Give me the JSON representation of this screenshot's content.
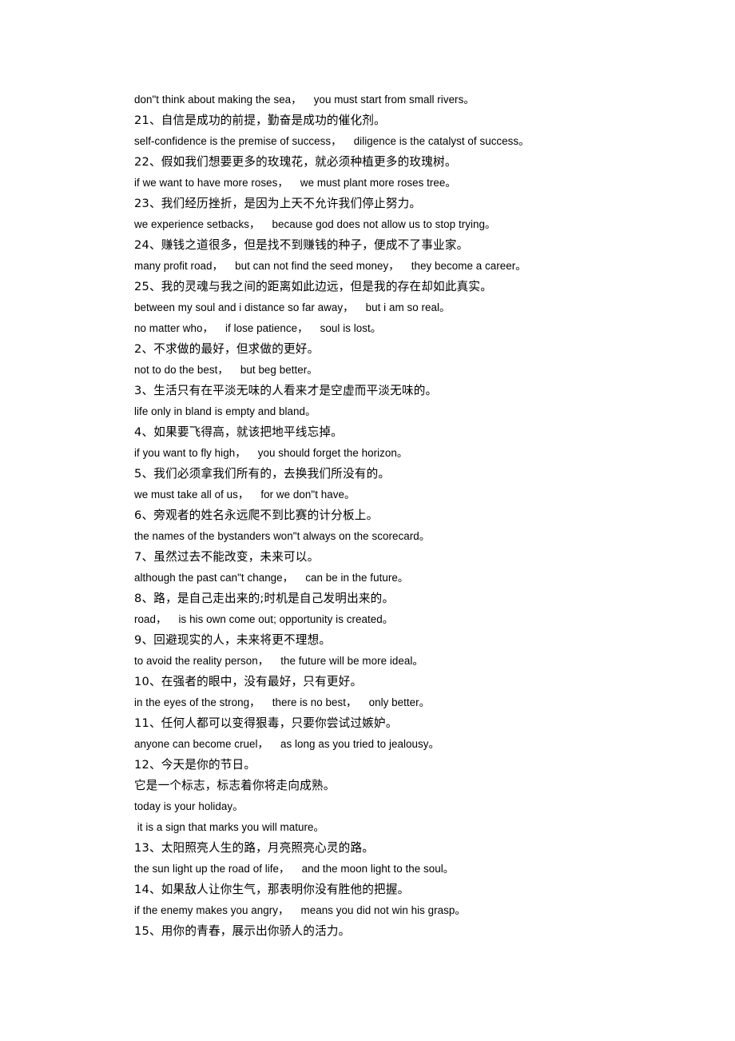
{
  "document": {
    "page_background": "#ffffff",
    "text_color": "#000000",
    "lines": [
      {
        "id": "l1",
        "script": "latin",
        "text": "don\"t think about making the sea，    you must start from small rivers。"
      },
      {
        "id": "l2",
        "script": "cjk",
        "text": "21、自信是成功的前提，勤奋是成功的催化剂。"
      },
      {
        "id": "l3",
        "script": "latin",
        "text": "self-confidence is the premise of success，    diligence is the catalyst of success。"
      },
      {
        "id": "l4",
        "script": "cjk",
        "text": "22、假如我们想要更多的玫瑰花，就必须种植更多的玫瑰树。"
      },
      {
        "id": "l5",
        "script": "latin",
        "text": "if we want to have more roses，    we must plant more roses tree。"
      },
      {
        "id": "l6",
        "script": "cjk",
        "text": "23、我们经历挫折，是因为上天不允许我们停止努力。"
      },
      {
        "id": "l7",
        "script": "latin",
        "text": "we experience setbacks，    because god does not allow us to stop trying。"
      },
      {
        "id": "l8",
        "script": "cjk",
        "text": "24、赚钱之道很多，但是找不到赚钱的种子，便成不了事业家。"
      },
      {
        "id": "l9",
        "script": "latin",
        "text": "many profit road，    but can not find the seed money，    they become a career。"
      },
      {
        "id": "l10",
        "script": "cjk",
        "text": "25、我的灵魂与我之间的距离如此边远，但是我的存在却如此真实。"
      },
      {
        "id": "l11",
        "script": "latin",
        "text": "between my soul and i distance so far away，    but i am so real。"
      },
      {
        "id": "l12",
        "script": "latin",
        "text": "no matter who，    if lose patience，    soul is lost。"
      },
      {
        "id": "l13",
        "script": "cjk",
        "text": "2、不求做的最好，但求做的更好。"
      },
      {
        "id": "l14",
        "script": "latin",
        "text": "not to do the best，    but beg better。"
      },
      {
        "id": "l15",
        "script": "cjk",
        "text": "3、生活只有在平淡无味的人看来才是空虚而平淡无味的。"
      },
      {
        "id": "l16",
        "script": "latin",
        "text": "life only in bland is empty and bland。"
      },
      {
        "id": "l17",
        "script": "cjk",
        "text": "4、如果要飞得高，就该把地平线忘掉。"
      },
      {
        "id": "l18",
        "script": "latin",
        "text": "if you want to fly high，    you should forget the horizon。"
      },
      {
        "id": "l19",
        "script": "cjk",
        "text": "5、我们必须拿我们所有的，去换我们所没有的。"
      },
      {
        "id": "l20",
        "script": "latin",
        "text": "we must take all of us，    for we don\"t have。"
      },
      {
        "id": "l21",
        "script": "cjk",
        "text": "6、旁观者的姓名永远爬不到比赛的计分板上。"
      },
      {
        "id": "l22",
        "script": "latin",
        "text": "the names of the bystanders won\"t always on the scorecard。"
      },
      {
        "id": "l23",
        "script": "cjk",
        "text": "7、虽然过去不能改变，未来可以。"
      },
      {
        "id": "l24",
        "script": "latin",
        "text": "although the past can\"t change，    can be in the future。"
      },
      {
        "id": "l25",
        "script": "cjk",
        "text": "8、路，是自己走出来的;时机是自己发明出来的。"
      },
      {
        "id": "l26",
        "script": "latin",
        "text": "road，    is his own come out; opportunity is created。"
      },
      {
        "id": "l27",
        "script": "cjk",
        "text": "9、回避现实的人，未来将更不理想。"
      },
      {
        "id": "l28",
        "script": "latin",
        "text": "to avoid the reality person，    the future will be more ideal。"
      },
      {
        "id": "l29",
        "script": "cjk",
        "text": "10、在强者的眼中，没有最好，只有更好。"
      },
      {
        "id": "l30",
        "script": "latin",
        "text": "in the eyes of the strong，    there is no best，    only better。"
      },
      {
        "id": "l31",
        "script": "cjk",
        "text": "11、任何人都可以变得狠毒，只要你尝试过嫉妒。"
      },
      {
        "id": "l32",
        "script": "latin",
        "text": "anyone can become cruel，    as long as you tried to jealousy。"
      },
      {
        "id": "l33",
        "script": "cjk",
        "text": "12、今天是你的节日。"
      },
      {
        "id": "l34",
        "script": "cjk",
        "text": "它是一个标志，标志着你将走向成熟。"
      },
      {
        "id": "l35",
        "script": "latin",
        "text": "today is your holiday。"
      },
      {
        "id": "l36",
        "script": "latin",
        "text": " it is a sign that marks you will mature。"
      },
      {
        "id": "l37",
        "script": "cjk",
        "text": "13、太阳照亮人生的路，月亮照亮心灵的路。"
      },
      {
        "id": "l38",
        "script": "latin",
        "text": "the sun light up the road of life，    and the moon light to the soul。"
      },
      {
        "id": "l39",
        "script": "cjk",
        "text": "14、如果敌人让你生气，那表明你没有胜他的把握。"
      },
      {
        "id": "l40",
        "script": "latin",
        "text": "if the enemy makes you angry，    means you did not win his grasp。"
      },
      {
        "id": "l41",
        "script": "cjk",
        "text": "15、用你的青春，展示出你骄人的活力。"
      }
    ]
  }
}
